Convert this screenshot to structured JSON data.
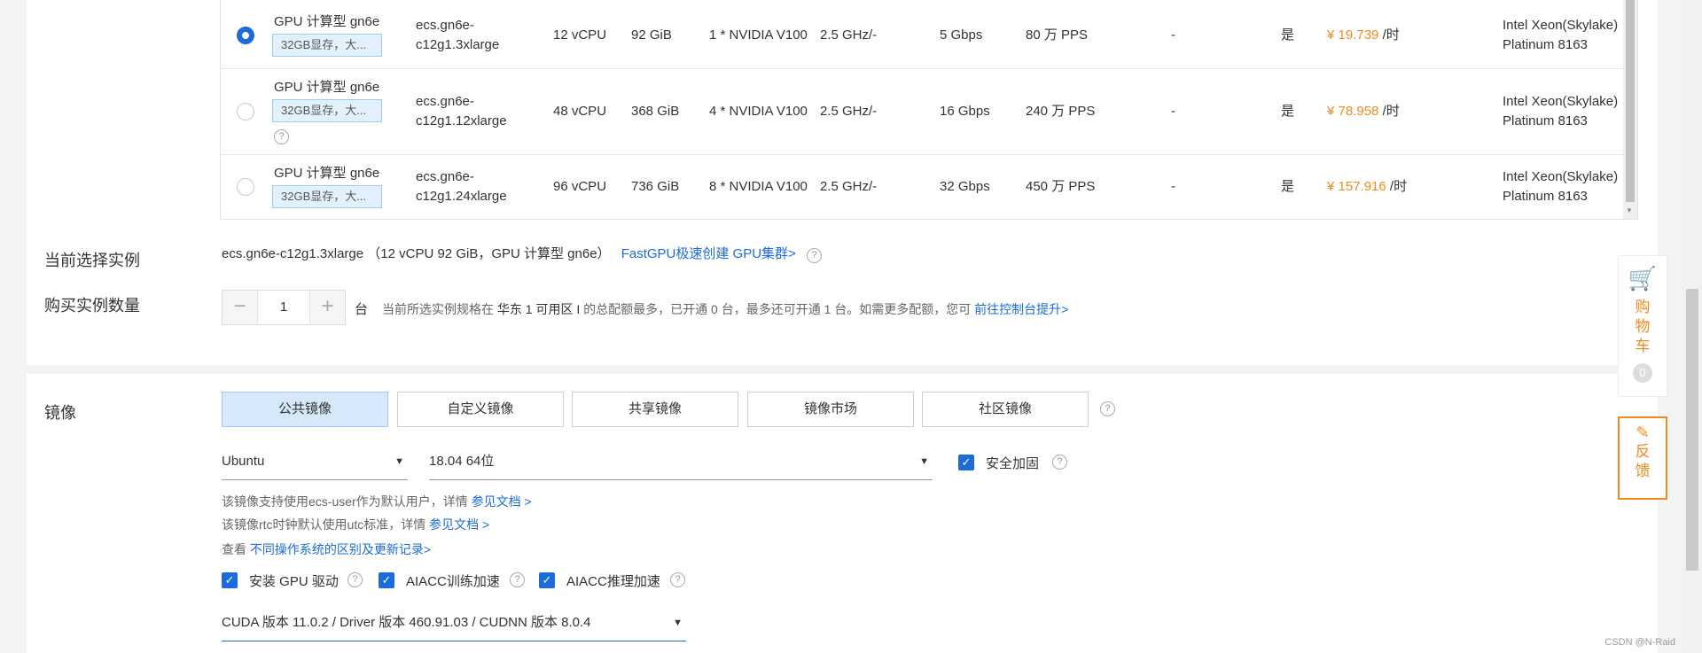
{
  "instances": [
    {
      "family": "GPU 计算型 gn6e",
      "tag": "32GB显存，大...",
      "spec_line1": "ecs.gn6e-",
      "spec_line2": "c12g1.3xlarge",
      "vcpu": "12 vCPU",
      "memory": "92 GiB",
      "gpu": "1 * NVIDIA V100",
      "freq": "2.5 GHz/-",
      "bandwidth": "5 Gbps",
      "pps": "80 万 PPS",
      "dash": "-",
      "ipv6": "是",
      "price": "¥ 19.739",
      "price_unit": "/时",
      "cpu_line1": "Intel Xeon(Skylake)",
      "cpu_line2": "Platinum 8163",
      "selected": true
    },
    {
      "family": "GPU 计算型 gn6e",
      "tag": "32GB显存，大...",
      "spec_line1": "ecs.gn6e-",
      "spec_line2": "c12g1.12xlarge",
      "vcpu": "48 vCPU",
      "memory": "368 GiB",
      "gpu": "4 * NVIDIA V100",
      "freq": "2.5 GHz/-",
      "bandwidth": "16 Gbps",
      "pps": "240 万 PPS",
      "dash": "-",
      "ipv6": "是",
      "price": "¥ 78.958",
      "price_unit": "/时",
      "cpu_line1": "Intel Xeon(Skylake)",
      "cpu_line2": "Platinum 8163",
      "selected": false
    },
    {
      "family": "GPU 计算型 gn6e",
      "tag": "32GB显存，大...",
      "spec_line1": "ecs.gn6e-",
      "spec_line2": "c12g1.24xlarge",
      "vcpu": "96 vCPU",
      "memory": "736 GiB",
      "gpu": "8 * NVIDIA V100",
      "freq": "2.5 GHz/-",
      "bandwidth": "32 Gbps",
      "pps": "450 万 PPS",
      "dash": "-",
      "ipv6": "是",
      "price": "¥ 157.916",
      "price_unit": "/时",
      "cpu_line1": "Intel Xeon(Skylake)",
      "cpu_line2": "Platinum 8163",
      "selected": false
    }
  ],
  "current": {
    "label": "当前选择实例",
    "value": "ecs.gn6e-c12g1.3xlarge （12 vCPU 92 GiB，GPU 计算型 gn6e）",
    "link": "FastGPU极速创建 GPU集群>"
  },
  "quantity": {
    "label": "购买实例数量",
    "minus": "−",
    "value": "1",
    "plus": "+",
    "unit": "台",
    "note_prefix": "当前所选实例规格在",
    "note_zone": "华东 1 可用区 I",
    "note_rest": "的总配额最多，已开通 0 台，最多还可开通 1 台。如需更多配额，您可",
    "note_link": "前往控制台提升>"
  },
  "image": {
    "label": "镜像",
    "tabs": [
      "公共镜像",
      "自定义镜像",
      "共享镜像",
      "镜像市场",
      "社区镜像"
    ],
    "os": "Ubuntu",
    "version": "18.04 64位",
    "security_label": "安全加固",
    "hint1": "该镜像支持使用ecs-user作为默认用户，详情",
    "hint1_link": "参见文档 >",
    "hint2": "该镜像rtc时钟默认使用utc标准，详情",
    "hint2_link": "参见文档 >",
    "hint3": "查看",
    "hint3_link": "不同操作系统的区别及更新记录>",
    "gpu_driver": "安装 GPU 驱动",
    "aiacc_train": "AIACC训练加速",
    "aiacc_infer": "AIACC推理加速",
    "cuda": "CUDA 版本 11.0.2 / Driver 版本 460.91.03 / CUDNN 版本 8.0.4"
  },
  "side": {
    "cart_label": "购物车",
    "cart_count": "0",
    "feedback_label": "反馈"
  },
  "watermark": "CSDN @N-Raid",
  "colors": {
    "accent": "#1b6cd9",
    "price": "#f08a1c"
  }
}
